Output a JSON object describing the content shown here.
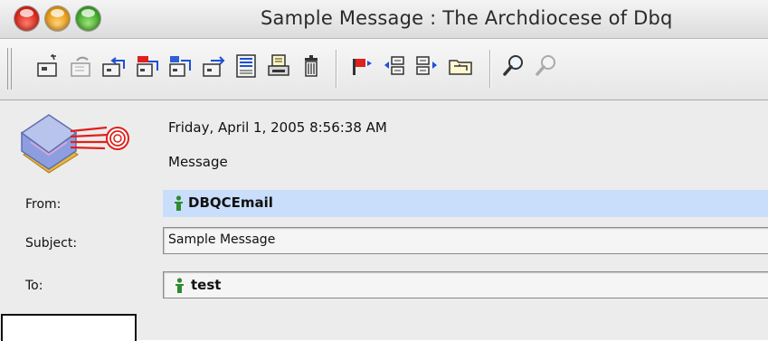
{
  "window": {
    "title": "Sample Message : The Archdiocese of Dbq"
  },
  "toolbar": {
    "buttons": [
      {
        "name": "new-message",
        "icon": "compose-icon"
      },
      {
        "name": "reply",
        "icon": "reply-icon"
      },
      {
        "name": "reply-all",
        "icon": "reply-all-icon"
      },
      {
        "name": "forward",
        "icon": "forward-icon"
      },
      {
        "name": "forward-as",
        "icon": "forward-as-icon"
      },
      {
        "name": "send",
        "icon": "send-icon"
      },
      {
        "name": "view-details",
        "icon": "list-icon"
      },
      {
        "name": "print",
        "icon": "print-icon"
      },
      {
        "name": "delete",
        "icon": "trash-icon"
      },
      {
        "name": "flag",
        "icon": "flag-icon"
      },
      {
        "name": "previous-message",
        "icon": "previous-icon"
      },
      {
        "name": "next-message",
        "icon": "next-icon"
      },
      {
        "name": "move-to-folder",
        "icon": "folder-icon"
      },
      {
        "name": "find",
        "icon": "magnifier-icon"
      },
      {
        "name": "find-next",
        "icon": "magnifier-disabled-icon"
      }
    ]
  },
  "message": {
    "date": "Friday, April 1, 2005 8:56:38 AM",
    "kind": "Message",
    "from_label": "From:",
    "from_value": "DBQCEmail",
    "subject_label": "Subject:",
    "subject_value": "Sample Message",
    "to_label": "To:",
    "to_value": "test"
  },
  "colors": {
    "from_highlight": "#c9defa",
    "person_icon": "#2e8b2e",
    "flag": "#e0201a",
    "arrow_blue": "#1e4fd6"
  }
}
